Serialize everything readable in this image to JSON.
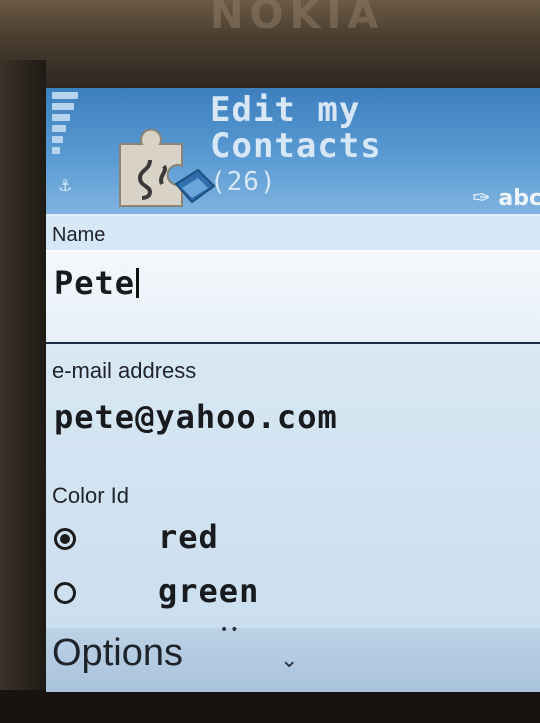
{
  "status_bar": {
    "signal_icon": "signal-bars-icon",
    "antenna_icon": "antenna-icon"
  },
  "header": {
    "title_line1": "Edit my",
    "title_line2": "Contacts",
    "count": "(26)",
    "app_icon": "puzzle-piece-icon",
    "input_mode": "abc",
    "input_mode_icon": "pen-input-icon"
  },
  "form": {
    "name_label": "Name",
    "name_value": "Pete",
    "email_label": "e-mail address",
    "email_value": "pete@yahoo.com",
    "color_label": "Color Id",
    "color_options": [
      {
        "label": "red",
        "selected": true
      },
      {
        "label": "green",
        "selected": false
      }
    ]
  },
  "softkeys": {
    "left": "Options",
    "scroll_icon": "chevron-down-icon"
  },
  "colors": {
    "header": "#4a8dc9",
    "screen_bg": "#dbe8f4",
    "text": "#181a1e"
  }
}
